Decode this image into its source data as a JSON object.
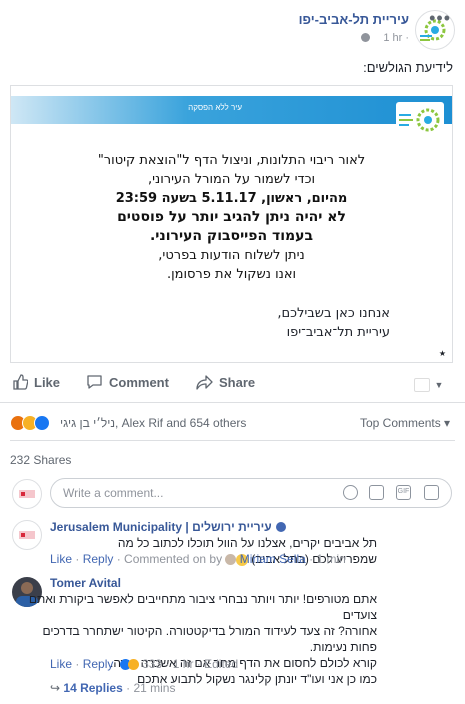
{
  "post": {
    "page_name": "עיריית תל-אביב-יפו",
    "time": "1 hr ·",
    "text": "לידיעת הגולשים:",
    "more": "•••"
  },
  "notice": {
    "bar_text": "עיר ללא הפסקה",
    "lines": [
      "לאור ריבוי התלונות, וניצול הדף ל\"הוצאת קיטור\"",
      "וכדי לשמור על המורל העירוני,",
      "מהיום, ראשון, 5.11.17 בשעה 23:59",
      "לא יהיה ניתן להגיב יותר על פוסטים",
      "בעמוד הפייסבוק העירוני.",
      "ניתן לשלוח הודעות בפרטי,",
      "ואנו נשקול את פרסומן."
    ],
    "sign": [
      "אנחנו כאן בשבילכם,",
      "עיריית תל־אביב־יפו"
    ],
    "star": "★"
  },
  "actions": {
    "like": "Like",
    "comment": "Comment",
    "share": "Share"
  },
  "reactions": {
    "summary": "ניל׳י בן גיגי, Alex Rif and 654 others",
    "top_comments": "Top Comments ▾",
    "shares": "232 Shares",
    "colors": {
      "angry": "#e9710f",
      "haha": "#f7b125",
      "like": "#1877f2"
    }
  },
  "composer": {
    "placeholder": "Write a comment..."
  },
  "comments": [
    {
      "name": "Jerusalem Municipality | עיריית ירושלים",
      "text": "תל אביבים יקרים, אצלנו על הוול תוכלו לכתוב כל מה שמפריע לכם (בתל אביב)",
      "like": "Like",
      "reply": "Reply",
      "meta": "· Commented on by",
      "by": "Miriam Sella",
      "time": "· 1 min"
    },
    {
      "name": "Tomer Avital",
      "lines": [
        "אתם מטורפים! יותר ויותר נבחרי ציבור מתחייבים לאפשר ביקורת ואתם צועדים",
        "אחורה? זה צעד לעידוד המורל בדיקטטורה. הקיטור ישתחרר בדרכים פחות נעימות.",
        "קורא לכולם לחסום את הדף מחר אם זה אשכרה קורה.",
        "כמו כן אני ועו\"ד יונתן קלינגר נשקול לתבוע אתכם"
      ],
      "like": "Like",
      "reply": "Reply",
      "reaction_count": "333",
      "time": "· 1 hr · Edited",
      "replies": "14 Replies",
      "replies_time": "· 21 mins"
    }
  ]
}
